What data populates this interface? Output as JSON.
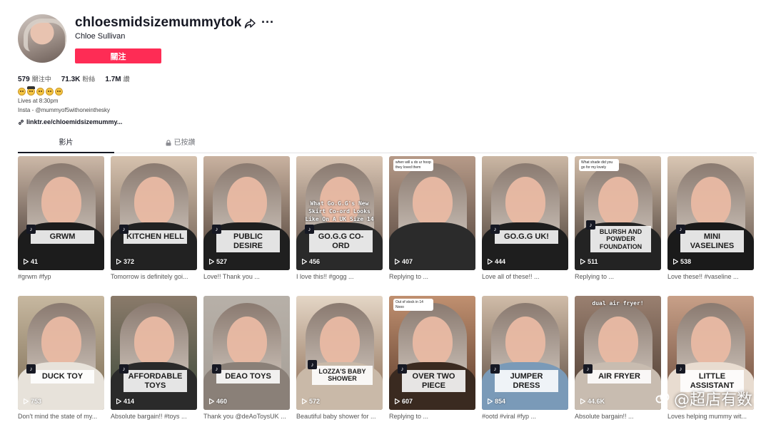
{
  "profile": {
    "username": "chloesmidsizemummytok",
    "nickname": "Chloe Sullivan",
    "follow_label": "關注",
    "stats": [
      {
        "value": "579",
        "label": "關注中"
      },
      {
        "value": "71.3K",
        "label": "粉絲"
      },
      {
        "value": "1.7M",
        "label": "讚"
      }
    ],
    "bio_line1": "Lives at 8:30pm",
    "bio_line2": "Insta - @mummyof5withoneinthesky",
    "link": "linktr.ee/chloemidsizemummy..."
  },
  "tabs": [
    {
      "label": "影片"
    },
    {
      "label": "已按讚"
    }
  ],
  "colors": {
    "accent": "#fe2c55",
    "text": "#161823"
  },
  "videos": [
    {
      "views": "41",
      "desc": "#grwm #fyp",
      "caption": "GRWM"
    },
    {
      "views": "372",
      "desc": "Tomorrow is definitely goi...",
      "caption": "KITCHEN HELL"
    },
    {
      "views": "527",
      "desc": "Love!! Thank you ...",
      "caption": "PUBLIC DESIRE"
    },
    {
      "views": "456",
      "desc": "I love this!! #gogg ...",
      "caption": "GO.G.G CO-ORD",
      "overlay": "What Go.G.G's New Skirt Co-ord Looks Like On A UK Size 14"
    },
    {
      "views": "407",
      "desc": "Replying to ...",
      "caption": "",
      "reply": "when will u do ur hoop they loved them"
    },
    {
      "views": "444",
      "desc": "Love all of these!! ...",
      "caption": "GO.G.G UK!"
    },
    {
      "views": "511",
      "desc": "Replying to ...",
      "caption": "BLURSH AND POWDER FOUNDATION",
      "reply": "What shade did you go for my lovely"
    },
    {
      "views": "538",
      "desc": "Love these!! #vaseline ...",
      "caption": "MINI VASELINES"
    },
    {
      "views": "753",
      "desc": "Don't mind the state of my...",
      "caption": "DUCK TOY"
    },
    {
      "views": "414",
      "desc": "Absolute bargain!! #toys ...",
      "caption": "AFFORDABLE TOYS"
    },
    {
      "views": "460",
      "desc": "Thank you @deAoToysUK ...",
      "caption": "DEAO TOYS"
    },
    {
      "views": "572",
      "desc": "Beautiful baby shower for ...",
      "caption": "LOZZA'S BABY SHOWER"
    },
    {
      "views": "607",
      "desc": "Replying to ...",
      "caption": "OVER TWO PIECE",
      "reply": "Out of stock in 14 Nooo"
    },
    {
      "views": "854",
      "desc": "#ootd #viral #fyp ...",
      "caption": "JUMPER DRESS"
    },
    {
      "views": "44.6K",
      "desc": "Absolute bargain!! ...",
      "caption": "AIR FRYER",
      "overlay": "dual air fryer!"
    },
    {
      "views": "",
      "desc": "Loves helping mummy wit...",
      "caption": "LITTLE ASSISTANT"
    }
  ],
  "watermark": "@超店有数"
}
